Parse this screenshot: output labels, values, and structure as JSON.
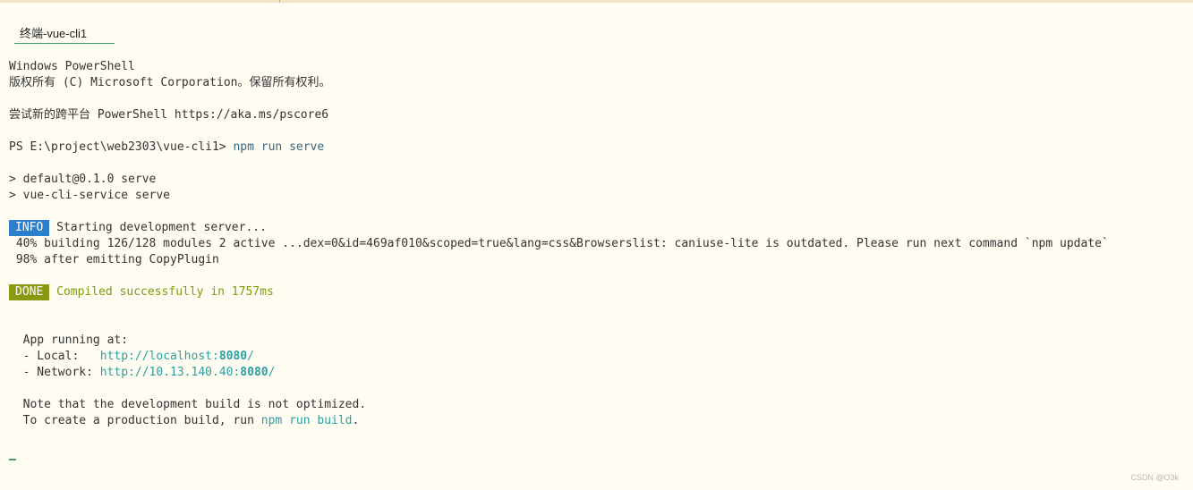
{
  "tab": {
    "title": "终端-vue-cli1"
  },
  "terminal": {
    "banner_line1": "Windows PowerShell",
    "banner_line2": "版权所有 (C) Microsoft Corporation。保留所有权利。",
    "try_line": "尝试新的跨平台 PowerShell https://aka.ms/pscore6",
    "prompt": "PS E:\\project\\web2303\\vue-cli1> ",
    "command": "npm run serve",
    "script_line1": "> default@0.1.0 serve",
    "script_line2": "> vue-cli-service serve",
    "info_badge": "INFO",
    "info_text": " Starting development server...",
    "progress_line1": " 40% building 126/128 modules 2 active ...dex=0&id=469af010&scoped=true&lang=css&Browserslist: caniuse-lite is outdated. Please run next command `npm update`",
    "progress_line2": " 98% after emitting CopyPlugin",
    "done_badge": "DONE",
    "done_text": " Compiled successfully in 1757ms",
    "app_running": "  App running at:",
    "local_label": "  - Local:   ",
    "local_url_prefix": "http://localhost:",
    "local_port": "8080",
    "local_url_suffix": "/",
    "network_label": "  - Network: ",
    "network_url_prefix": "http://10.13.140.40:",
    "network_port": "8080",
    "network_url_suffix": "/",
    "note_line1": "  Note that the development build is not optimized.",
    "note_line2_prefix": "  To create a production build, run ",
    "note_line2_cmd": "npm run build",
    "note_line2_suffix": "."
  },
  "watermark": "CSDN @O3k",
  "colors": {
    "background": "#fffcf2",
    "info": "#2c7fcc",
    "done": "#8a9a10",
    "link": "#2c9fa0",
    "success": "#7a9c10"
  }
}
